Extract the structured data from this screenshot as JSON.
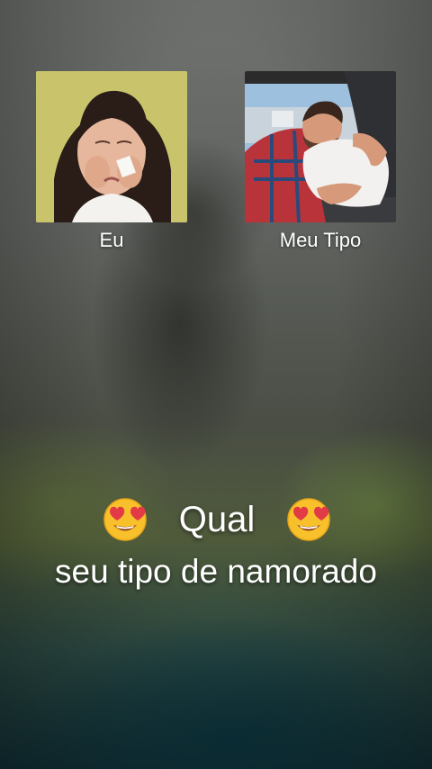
{
  "cards": {
    "left_caption": "Eu",
    "right_caption": "Meu Tipo"
  },
  "headline": {
    "word": "Qual",
    "subline": "seu tipo de namorado",
    "emoji": "heart-eyes-face"
  },
  "colors": {
    "text": "#ffffff",
    "left_photo_bg": "#c8c46a",
    "right_photo_sky": "#8fb6d8"
  }
}
